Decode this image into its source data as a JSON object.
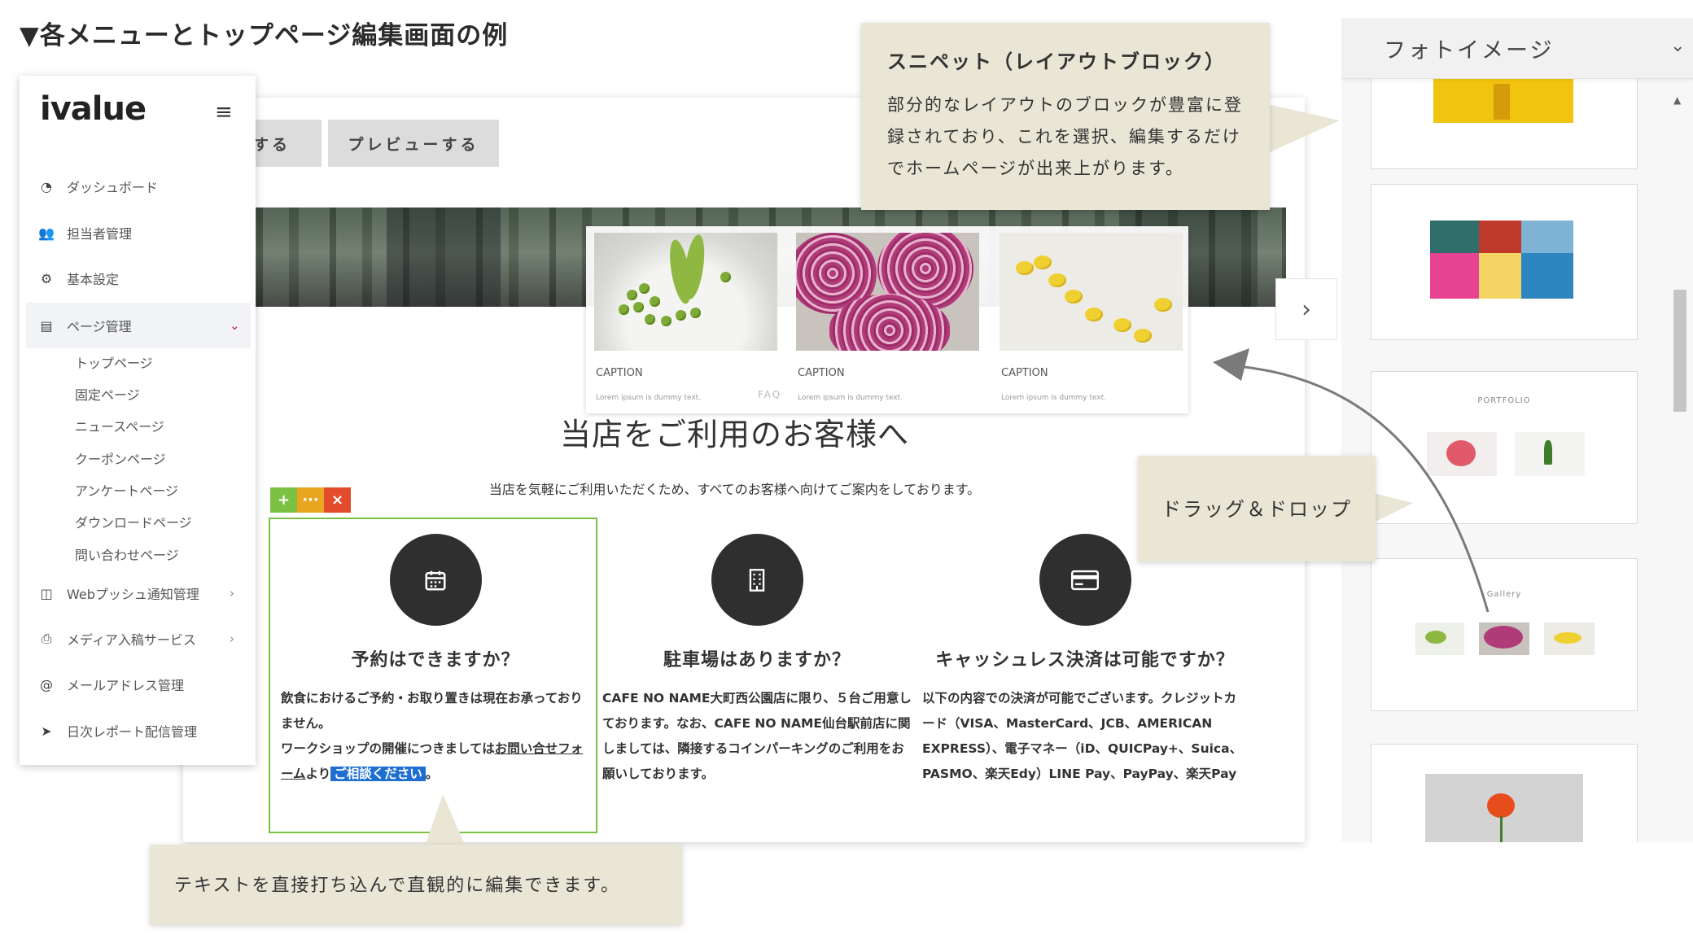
{
  "page_title": "▼各メニューとトップページ編集画面の例",
  "sidebar": {
    "logo": "ivalue",
    "items": [
      {
        "label": "ダッシュボード",
        "icon": "dashboard-icon"
      },
      {
        "label": "担当者管理",
        "icon": "users-icon"
      },
      {
        "label": "基本設定",
        "icon": "gear-icon"
      },
      {
        "label": "ページ管理",
        "icon": "document-icon"
      },
      {
        "label": "Webプッシュ通知管理",
        "icon": "columns-icon"
      },
      {
        "label": "メディア入稿サービス",
        "icon": "printer-icon"
      },
      {
        "label": "メールアドレス管理",
        "icon": "at-icon"
      },
      {
        "label": "日次レポート配信管理",
        "icon": "send-icon"
      }
    ],
    "subitems": [
      "トップページ",
      "固定ページ",
      "ニュースページ",
      "クーポンページ",
      "アンケートページ",
      "ダウンロードページ",
      "問い合わせページ"
    ]
  },
  "editor": {
    "save_label": "する",
    "preview_label": "プレビューする",
    "gallery": [
      {
        "caption": "CAPTION",
        "text": "Lorem ipsum is dummy text."
      },
      {
        "caption": "CAPTION",
        "text": "Lorem ipsum is dummy text."
      },
      {
        "caption": "CAPTION",
        "text": "Lorem ipsum is dummy text."
      }
    ],
    "faq_label": "FAQ",
    "section_title": "当店をご利用のお客様へ",
    "section_lead": "当店を気軽にご利用いただくため、すべてのお客様へ向けてご案内をしております。",
    "toolbar": {
      "add": "+",
      "more": "···",
      "delete": "×"
    },
    "columns": [
      {
        "title": "予約はできますか？",
        "body_1": "飲食におけるご予約・お取り置きは現在お承っておりません。",
        "body_2": "ワークショップの開催につきましては",
        "link_1": "お問い合せフォーム",
        "body_3": "より",
        "selected": "ご相談ください",
        "body_4": "。"
      },
      {
        "title": "駐車場はありますか？",
        "body": "CAFE NO NAME大町西公園店に限り、５台ご用意しております。なお、CAFE NO NAME仙台駅前店に関しましては、隣接するコインパーキングのご利用をお願いしております。"
      },
      {
        "title": "キャッシュレス決済は可能ですか？",
        "body": "以下の内容での決済が可能でございます。クレジットカード（VISA、MasterCard、JCB、AMERICAN EXPRESS）、電子マネー（iD、QUICPay+、Suica、PASMO、楽天Edy）LINE Pay、PayPay、楽天Pay"
      }
    ]
  },
  "callouts": {
    "snippet_title": "スニペット（レイアウトブロック）",
    "snippet_body": "部分的なレイアウトのブロックが豊富に登録されており、これを選択、編集するだけでホームページが出来上がります。",
    "drag": "ドラッグ＆ドロップ",
    "text_edit": "テキストを直接打ち込んで直観的に編集できます。"
  },
  "right_panel": {
    "title": "フォトイメージ",
    "card_labels": [
      "PORTFOLIO",
      "Gallery"
    ]
  },
  "colors": {
    "callout_bg": "#e9e6d6",
    "toolbar_add": "#7cc143",
    "toolbar_more": "#e8a621",
    "toolbar_delete": "#e24b2c",
    "selection": "#1e6fd1",
    "icon_circle": "#2f2f2f"
  }
}
